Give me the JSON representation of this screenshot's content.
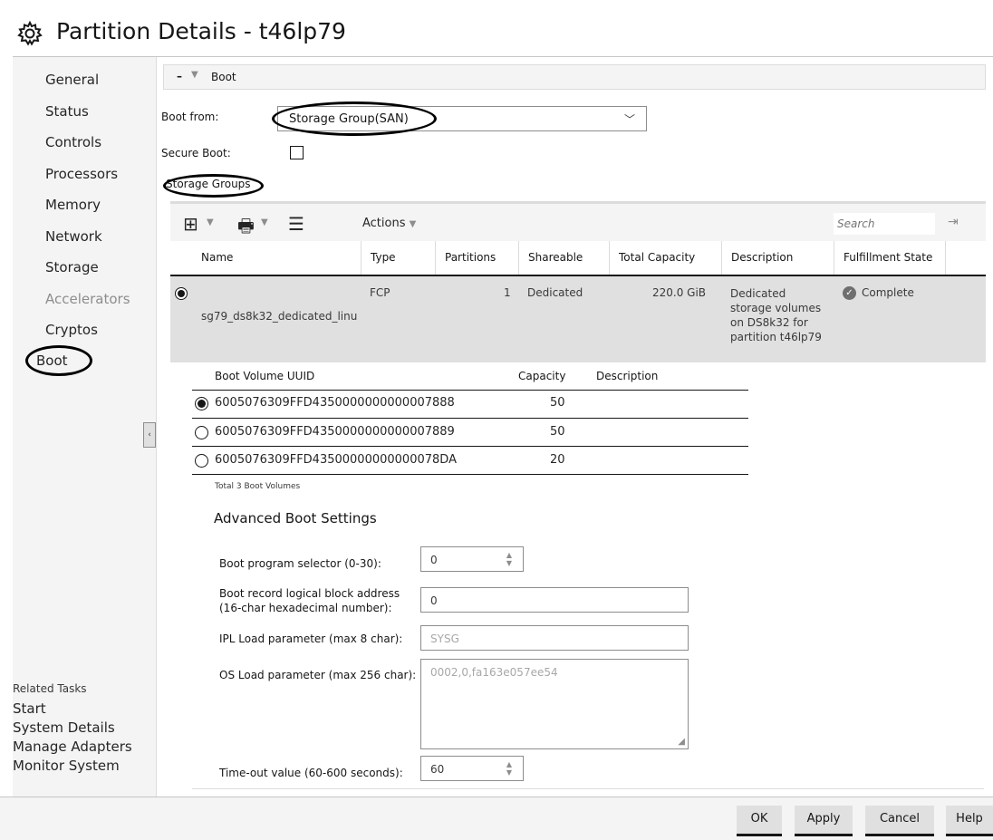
{
  "window": {
    "title": "Partition Details - t46lp79",
    "icon": "gear-icon"
  },
  "sidebar": {
    "items": [
      {
        "label": "General",
        "disabled": false
      },
      {
        "label": "Status",
        "disabled": false
      },
      {
        "label": "Controls",
        "disabled": false
      },
      {
        "label": "Processors",
        "disabled": false
      },
      {
        "label": "Memory",
        "disabled": false
      },
      {
        "label": "Network",
        "disabled": false
      },
      {
        "label": "Storage",
        "disabled": false
      },
      {
        "label": "Accelerators",
        "disabled": true
      },
      {
        "label": "Cryptos",
        "disabled": false
      },
      {
        "label": "Boot",
        "disabled": false,
        "selected": true
      }
    ],
    "related_tasks": {
      "heading": "Related Tasks",
      "links": [
        "Start",
        "System Details",
        "Manage Adapters",
        "Monitor System"
      ]
    }
  },
  "section": {
    "toggle": "–",
    "title": "Boot"
  },
  "boot_from": {
    "label": "Boot from:",
    "value": "Storage Group(SAN)"
  },
  "secure_boot": {
    "label": "Secure Boot:",
    "checked": false
  },
  "storage_groups": {
    "label": "Storage Groups",
    "toolbar": {
      "actions_label": "Actions",
      "search_placeholder": "Search"
    },
    "columns": [
      "Name",
      "Type",
      "Partitions",
      "Shareable",
      "Total Capacity",
      "Description",
      "Fulfillment State"
    ],
    "rows": [
      {
        "name": "sg79_ds8k32_dedicated_linu",
        "type": "FCP",
        "partitions": "1",
        "shareable": "Dedicated",
        "total_capacity": "220.0 GiB",
        "description": "Dedicated storage volumes on DS8k32 for partition t46lp79",
        "fulfillment_state": "Complete",
        "selected": true
      }
    ]
  },
  "boot_volumes": {
    "columns": [
      "Boot Volume UUID",
      "Capacity",
      "Description"
    ],
    "rows": [
      {
        "uuid": "6005076309FFD4350000000000007888",
        "capacity": "50",
        "description": "",
        "selected": true
      },
      {
        "uuid": "6005076309FFD4350000000000007889",
        "capacity": "50",
        "description": "",
        "selected": false
      },
      {
        "uuid": "6005076309FFD43500000000000078DA",
        "capacity": "20",
        "description": "",
        "selected": false
      }
    ],
    "total": "Total 3 Boot Volumes"
  },
  "advanced": {
    "title": "Advanced Boot Settings",
    "boot_program_selector": {
      "label": "Boot program selector (0-30):",
      "value": "0"
    },
    "boot_record_lba": {
      "label_line1": "Boot record logical block address",
      "label_line2": "(16-char hexadecimal number):",
      "value": "0"
    },
    "ipl_load_parameter": {
      "label": "IPL Load parameter (max 8 char):",
      "value": "SYSG"
    },
    "os_load_parameter": {
      "label": "OS Load parameter (max 256 char):",
      "value": "0002,0,fa163e057ee54"
    },
    "timeout": {
      "label": "Time-out value (60-600 seconds):",
      "value": "60"
    }
  },
  "footer": {
    "buttons": [
      "OK",
      "Apply",
      "Cancel",
      "Help"
    ]
  }
}
